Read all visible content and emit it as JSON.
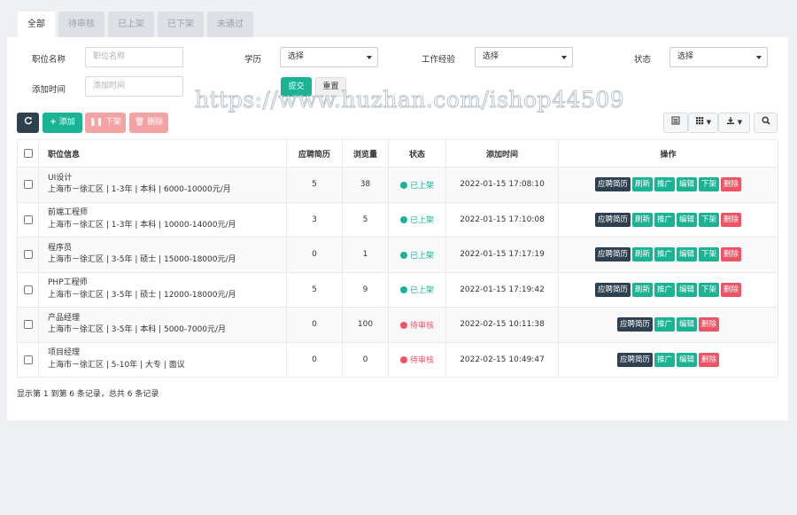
{
  "tabs": [
    "全部",
    "待审核",
    "已上架",
    "已下架",
    "未通过"
  ],
  "filters": {
    "position_label": "职位名称",
    "position_placeholder": "职位名称",
    "education_label": "学历",
    "education_value": "选择",
    "experience_label": "工作经验",
    "experience_value": "选择",
    "status_label": "状态",
    "status_value": "选择",
    "time_label": "添加时间",
    "time_placeholder": "添加时间",
    "submit": "提交",
    "reset": "重置"
  },
  "watermark": "https://www.huzhan.com/ishop44509",
  "toolbar": {
    "add": "添加",
    "offline": "下架",
    "delete": "删除"
  },
  "table": {
    "headers": [
      "职位信息",
      "应聘简历",
      "浏览量",
      "状态",
      "添加时间",
      "操作"
    ],
    "rows": [
      {
        "title": "UI设计",
        "detail": "上海市－徐汇区 | 1-3年 | 本科 | 6000-10000元/月",
        "resumes": "5",
        "views": "38",
        "status": "已上架",
        "status_type": "online",
        "time": "2022-01-15 17:08:10"
      },
      {
        "title": "前端工程师",
        "detail": "上海市－徐汇区 | 1-3年 | 本科 | 10000-14000元/月",
        "resumes": "3",
        "views": "5",
        "status": "已上架",
        "status_type": "online",
        "time": "2022-01-15 17:10:08"
      },
      {
        "title": "程序员",
        "detail": "上海市－徐汇区 | 3-5年 | 硕士 | 15000-18000元/月",
        "resumes": "0",
        "views": "1",
        "status": "已上架",
        "status_type": "online",
        "time": "2022-01-15 17:17:19"
      },
      {
        "title": "PHP工程师",
        "detail": "上海市－徐汇区 | 3-5年 | 硕士 | 12000-18000元/月",
        "resumes": "5",
        "views": "9",
        "status": "已上架",
        "status_type": "online",
        "time": "2022-01-15 17:19:42"
      },
      {
        "title": "产品经理",
        "detail": "上海市－徐汇区 | 3-5年 | 本科 | 5000-7000元/月",
        "resumes": "0",
        "views": "100",
        "status": "待审核",
        "status_type": "pending",
        "time": "2022-02-15 10:11:38"
      },
      {
        "title": "项目经理",
        "detail": "上海市－徐汇区 | 5-10年 | 大专 | 面议",
        "resumes": "0",
        "views": "0",
        "status": "待审核",
        "status_type": "pending",
        "time": "2022-02-15 10:49:47"
      }
    ]
  },
  "actions": {
    "resume": "应聘简历",
    "refresh": "刷新",
    "promote": "推广",
    "edit": "编辑",
    "offline": "下架",
    "delete": "删除"
  },
  "colors": {
    "online": "#1ab394",
    "pending": "#ed5565",
    "dark": "#2f4050"
  },
  "footer": "显示第 1 到第 6 条记录，总共 6 条记录"
}
